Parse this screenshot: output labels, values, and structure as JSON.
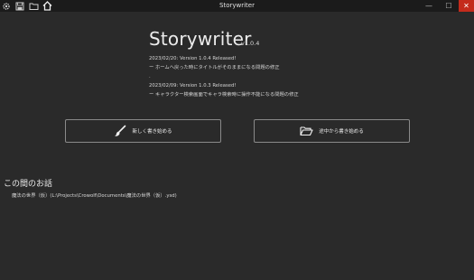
{
  "window": {
    "title": "Storywriter",
    "controls": {
      "minimize": "—",
      "maximize": "☐",
      "close": "✕"
    }
  },
  "toolbar": {
    "icons": [
      "gear-icon",
      "save-icon",
      "folder-icon",
      "home-icon"
    ]
  },
  "app": {
    "name": "Storywriter",
    "version": "v1.0.4"
  },
  "news": [
    "2023/02/20: Version 1.0.4 Released!",
    "ー ホームへ戻った時にタイトルがそのままになる問題の修正",
    ".",
    "2023/02/09: Version 1.0.3 Released!",
    "ー キャラクター検索画面でキャラ検索時に操作不能になる問題の修正"
  ],
  "buttons": {
    "new_label": "新しく書き始める",
    "continue_label": "途中から書き始める"
  },
  "recent": {
    "heading": "この間のお話",
    "items": [
      "魔法の世界（仮）(L:\\Projects\\Crowolf\\Documents\\魔法の世界（仮）.ysd)"
    ]
  },
  "colors": {
    "background": "#2a2a2a",
    "titlebar": "#1b1b1b",
    "close_hover": "#c42b1c",
    "button_border": "#8a8a8a"
  }
}
